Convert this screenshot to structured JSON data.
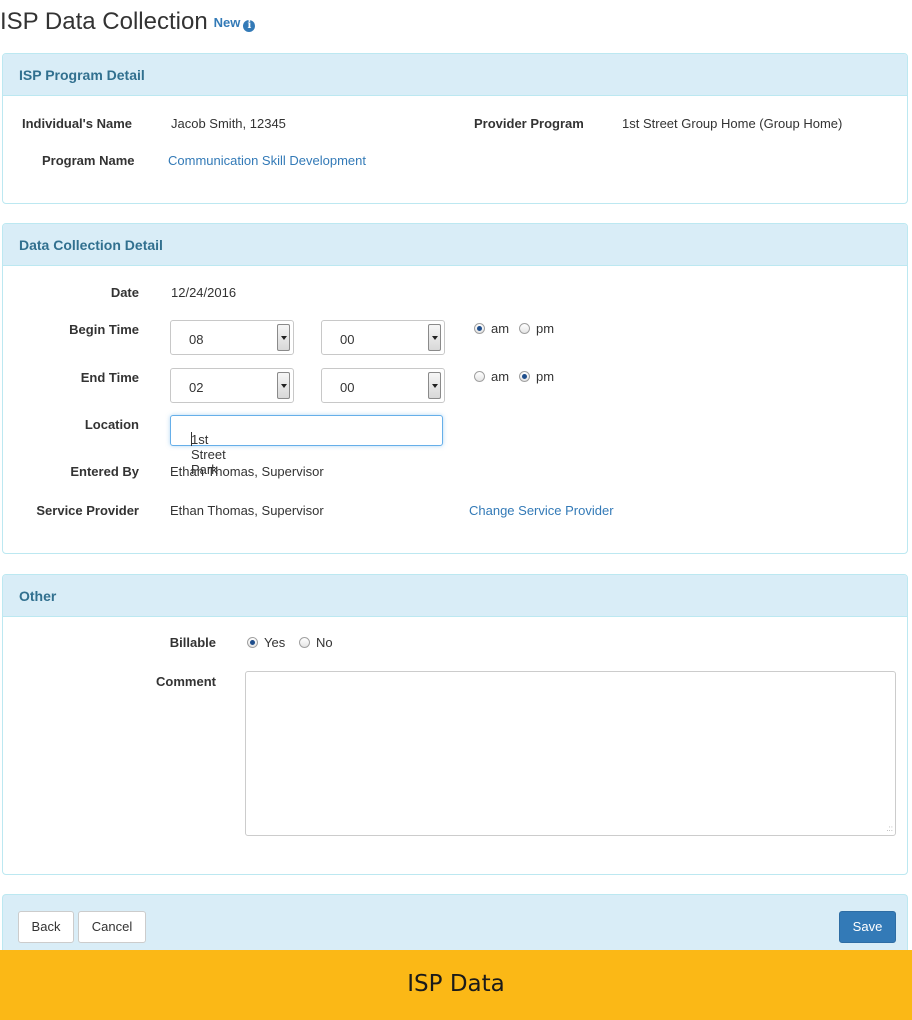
{
  "header": {
    "title": "ISP Data Collection",
    "badge": "New",
    "info_icon": "info-circle-icon"
  },
  "program_detail": {
    "heading": "ISP Program Detail",
    "individual_name_label": "Individual's Name",
    "individual_name_value": "Jacob Smith, 12345",
    "provider_program_label": "Provider Program",
    "provider_program_value": "1st Street Group Home (Group Home)",
    "program_name_label": "Program Name",
    "program_name_value": "Communication Skill Development"
  },
  "data_detail": {
    "heading": "Data Collection Detail",
    "date_label": "Date",
    "date_value": "12/24/2016",
    "begin_time_label": "Begin Time",
    "begin_hour": "08",
    "begin_minute": "00",
    "end_time_label": "End Time",
    "end_hour": "02",
    "end_minute": "00",
    "am_label": "am",
    "pm_label": "pm",
    "begin_meridiem": "am",
    "end_meridiem": "pm",
    "location_label": "Location",
    "location_value": "1st Street Park",
    "entered_by_label": "Entered By",
    "entered_by_value": "Ethan Thomas, Supervisor",
    "service_provider_label": "Service Provider",
    "service_provider_value": "Ethan Thomas, Supervisor",
    "change_provider_link": "Change Service Provider"
  },
  "other": {
    "heading": "Other",
    "billable_label": "Billable",
    "yes_label": "Yes",
    "no_label": "No",
    "billable_value": "Yes",
    "comment_label": "Comment",
    "comment_value": ""
  },
  "footer": {
    "back_label": "Back",
    "cancel_label": "Cancel",
    "save_label": "Save"
  },
  "banner": {
    "text": "ISP Data"
  },
  "colors": {
    "panel_heading_bg": "#d9edf7",
    "panel_heading_text": "#31708f",
    "link": "#337ab7",
    "primary_button": "#337ab7",
    "banner_bg": "#fbb816"
  }
}
